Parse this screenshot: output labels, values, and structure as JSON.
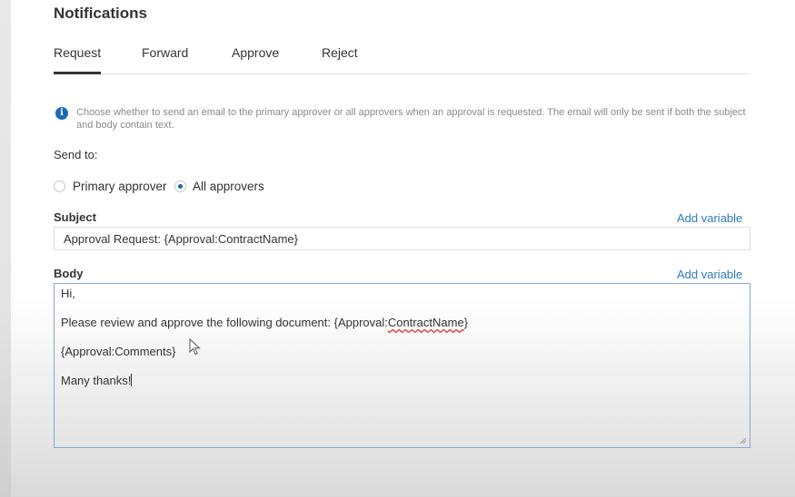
{
  "page": {
    "title": "Notifications"
  },
  "tabs": [
    {
      "label": "Request",
      "active": true
    },
    {
      "label": "Forward",
      "active": false
    },
    {
      "label": "Approve",
      "active": false
    },
    {
      "label": "Reject",
      "active": false
    }
  ],
  "info": {
    "icon": "info-icon",
    "text": "Choose whether to send an email to the primary approver or all approvers when an approval is requested. The email will only be sent if both the subject and body contain text."
  },
  "send_to": {
    "label": "Send to:",
    "options": [
      {
        "label": "Primary approver",
        "checked": false
      },
      {
        "label": "All approvers",
        "checked": true
      }
    ]
  },
  "subject": {
    "label": "Subject",
    "add_variable": "Add variable",
    "value": "Approval Request: {Approval:ContractName}"
  },
  "body": {
    "label": "Body",
    "add_variable": "Add variable",
    "lines": {
      "greeting": "Hi,",
      "request_prefix": "Please review and approve the following document: {Approval:",
      "request_var": "ContractName",
      "request_suffix": "}",
      "comments": "{Approval:Comments}",
      "signoff": "Many thanks!"
    }
  },
  "colors": {
    "accent": "#1a67b3",
    "link": "#2f7bbf",
    "focus_border": "#7ea9d3"
  }
}
